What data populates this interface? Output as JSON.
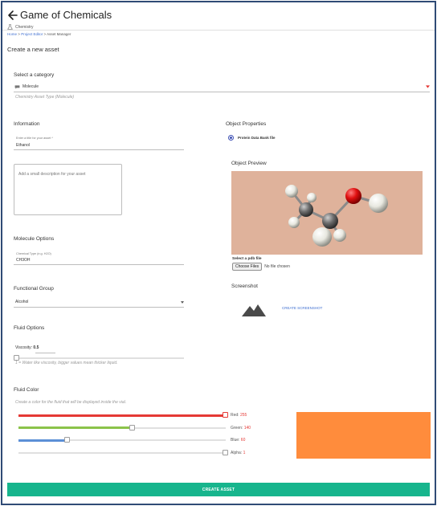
{
  "header": {
    "title": "Game of Chemicals",
    "subtitle": "Chemistry",
    "breadcrumb": [
      {
        "label": "Home",
        "link": true
      },
      {
        "label": "Project Editor",
        "link": true
      },
      {
        "label": "Asset Manager",
        "link": false
      }
    ],
    "breadcrumb_separator": ">"
  },
  "page_title": "Create a new asset",
  "category": {
    "heading": "Select a category",
    "selected": "Molecule",
    "hint": "Chemistry Asset Type (Molecule)"
  },
  "information": {
    "heading": "Information",
    "title_label": "Enter a title for your asset *",
    "title_value": "Ethanol",
    "description_placeholder": "Add a small description for your asset"
  },
  "molecule_options": {
    "heading": "Molecule Options",
    "type_label": "Chemical Type (e.g. H2O)",
    "type_value": "CH3OH"
  },
  "functional_group": {
    "heading": "Functional Group",
    "selected": "Alcohol"
  },
  "fluid_options": {
    "heading": "Fluid Options",
    "viscosity_label": "Viscosity:",
    "viscosity_value": "0.5",
    "viscosity_fraction": 0.0,
    "hint": "1 = Water like viscosity, bigger values mean thicker liquid."
  },
  "fluid_color": {
    "heading": "Fluid Color",
    "hint": "Create a color for the fluid that will be displayed inside the vial.",
    "sliders": [
      {
        "label": "Red:",
        "value": "255",
        "fraction": 1.0,
        "color": "#e53935"
      },
      {
        "label": "Green:",
        "value": "140",
        "fraction": 0.549,
        "color": "#8bc34a"
      },
      {
        "label": "Blue:",
        "value": "60",
        "fraction": 0.235,
        "color": "#5b8fd6"
      },
      {
        "label": "Alpha:",
        "value": "1",
        "fraction": 1.0,
        "color": "#e0e0e0"
      }
    ],
    "swatch_color": "#ff8c3c"
  },
  "object_properties": {
    "heading": "Object Properties",
    "radio_label": "Protein Data Bank file",
    "radio_selected": true
  },
  "object_preview": {
    "heading": "Object Preview",
    "background": "#dfb29b",
    "pdb_label": "Select a pdb file",
    "choose_button": "Choose Files",
    "no_file": "No file chosen"
  },
  "screenshot": {
    "heading": "Screenshot",
    "create_link": "CREATE SCREENSHOT"
  },
  "create_button": "CREATE ASSET",
  "colors": {
    "accent": "#17b58d",
    "link": "#3f6fd1",
    "frame": "#2f4a75"
  }
}
